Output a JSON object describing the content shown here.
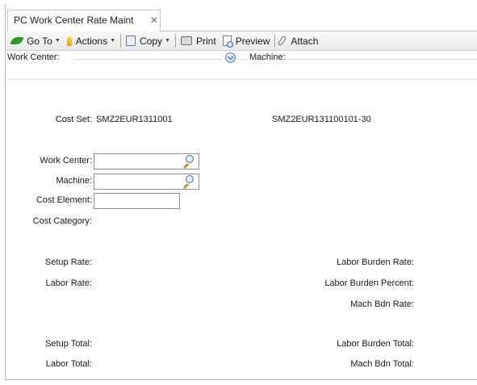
{
  "window": {
    "tab_label": "PC Work Center Rate Maint",
    "tab_close_glyph": "✕"
  },
  "toolbar": {
    "goto_label": "Go To",
    "actions_label": "Actions",
    "copy_label": "Copy",
    "print_label": "Print",
    "preview_label": "Preview",
    "attach_label": "Attach"
  },
  "header_bar": {
    "work_center_label": "Work Center:",
    "machine_label": "Machine:"
  },
  "form": {
    "cost_set_label": "Cost Set:",
    "cost_set_value": "SMZ2EUR1311001",
    "cost_set_description": "SMZ2EUR131100101-30",
    "work_center_label": "Work Center:",
    "work_center_value": "",
    "machine_label": "Machine:",
    "machine_value": "",
    "cost_element_label": "Cost Element:",
    "cost_element_value": "",
    "cost_category_label": "Cost Category:",
    "setup_rate_label": "Setup Rate:",
    "labor_rate_label": "Labor Rate:",
    "labor_burden_rate_label": "Labor Burden Rate:",
    "labor_burden_percent_label": "Labor Burden Percent:",
    "mach_bdn_rate_label": "Mach Bdn Rate:",
    "setup_total_label": "Setup Total:",
    "labor_total_label": "Labor Total:",
    "labor_burden_total_label": "Labor Burden Total:",
    "mach_bdn_total_label": "Mach Bdn Total:"
  },
  "icons": {
    "goto": "arrow-icon",
    "actions": "lightning-icon",
    "copy": "copy-icon",
    "print": "printer-icon",
    "preview": "preview-icon",
    "attach": "paperclip-icon",
    "collapse": "chevron-down-circle-icon",
    "search": "search-icon"
  },
  "colors": {
    "accent_green": "#2f9a23",
    "accent_blue": "#3a72b8",
    "border": "#8f8f8f"
  }
}
